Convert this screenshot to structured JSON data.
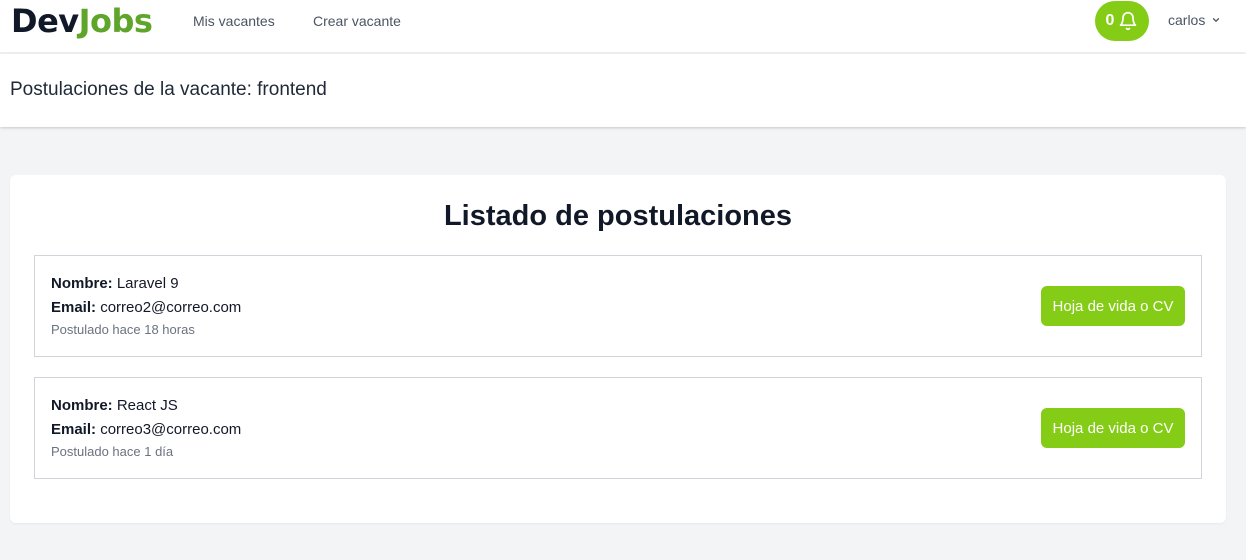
{
  "nav": {
    "logo_part1": "Dev",
    "logo_part2": "Jobs",
    "links": [
      "Mis vacantes",
      "Crear vacante"
    ],
    "notifications_count": "0",
    "user_name": "carlos"
  },
  "header": {
    "title": "Postulaciones de la vacante: frontend"
  },
  "main": {
    "heading": "Listado de postulaciones",
    "name_label": "Nombre:",
    "email_label": "Email:",
    "cv_button_label": "Hoja de vida o CV",
    "applicants": [
      {
        "name": "Laravel 9",
        "email": "correo2@correo.com",
        "posted": "Postulado hace 18 horas"
      },
      {
        "name": "React JS",
        "email": "correo3@correo.com",
        "posted": "Postulado hace 1 día"
      }
    ]
  },
  "colors": {
    "accent": "#84cc16",
    "logo_accent": "#5fa52a",
    "background": "#f3f4f6"
  },
  "icons": [
    "bell-icon",
    "chevron-down-icon"
  ]
}
